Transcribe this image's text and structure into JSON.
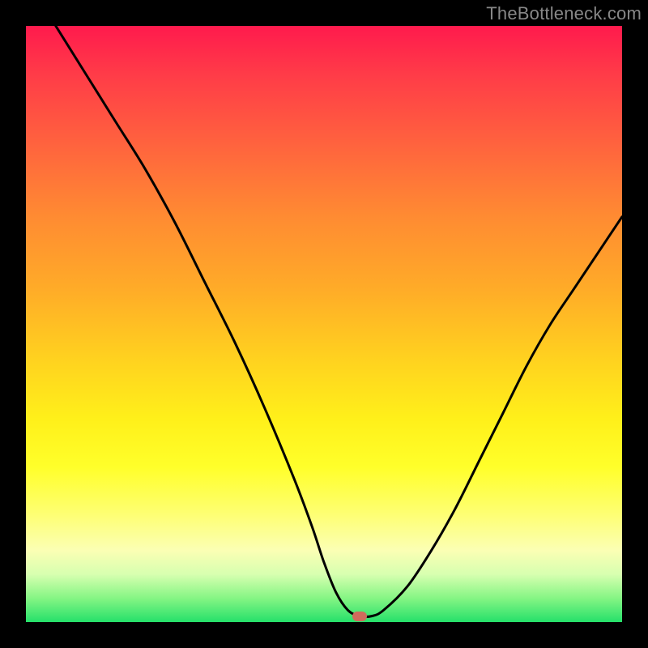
{
  "attribution": "TheBottleneck.com",
  "chart_data": {
    "type": "line",
    "title": "",
    "xlabel": "",
    "ylabel": "",
    "xlim": [
      0,
      100
    ],
    "ylim": [
      0,
      100
    ],
    "series": [
      {
        "name": "bottleneck-curve",
        "x": [
          5,
          10,
          15,
          20,
          25,
          30,
          35,
          40,
          45,
          48,
          50,
          52,
          54,
          56,
          58,
          60,
          64,
          68,
          72,
          76,
          80,
          84,
          88,
          92,
          96,
          100
        ],
        "values": [
          100,
          92,
          84,
          76,
          67,
          57,
          47,
          36,
          24,
          16,
          10,
          5,
          2,
          1,
          1,
          2,
          6,
          12,
          19,
          27,
          35,
          43,
          50,
          56,
          62,
          68
        ]
      }
    ],
    "marker": {
      "x": 56,
      "y": 1
    },
    "background_gradient": {
      "top": "#ff1a4d",
      "mid": "#ffd21f",
      "bottom": "#25e06a"
    }
  }
}
